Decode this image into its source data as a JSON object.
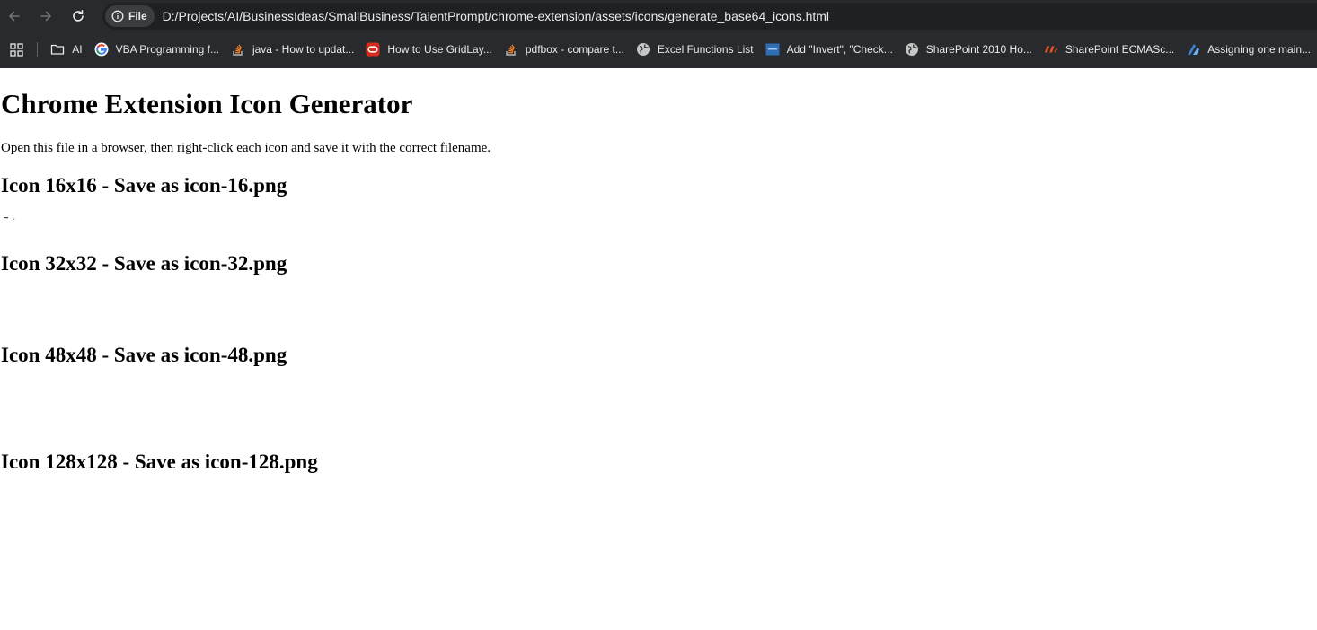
{
  "browser": {
    "site_chip_label": "File",
    "url": "D:/Projects/AI/BusinessIdeas/SmallBusiness/TalentPrompt/chrome-extension/assets/icons/generate_base64_icons.html",
    "bookmarks": [
      {
        "label": "AI",
        "icon": "folder-icon"
      },
      {
        "label": "VBA Programming f...",
        "icon": "google-icon"
      },
      {
        "label": "java - How to updat...",
        "icon": "stackoverflow-icon"
      },
      {
        "label": "How to Use GridLay...",
        "icon": "oracle-icon"
      },
      {
        "label": "pdfbox - compare t...",
        "icon": "stackoverflow-icon"
      },
      {
        "label": "Excel Functions List",
        "icon": "globe-icon"
      },
      {
        "label": "Add \"Invert\", \"Check...",
        "icon": "site-icon"
      },
      {
        "label": "SharePoint 2010 Ho...",
        "icon": "globe-icon"
      },
      {
        "label": "SharePoint ECMASc...",
        "icon": "site-logo-icon"
      },
      {
        "label": "Assigning one main...",
        "icon": "site-icon"
      }
    ]
  },
  "page": {
    "title": "Chrome Extension Icon Generator",
    "instructions": "Open this file in a browser, then right-click each icon and save it with the correct filename.",
    "sections": [
      {
        "heading": "Icon 16x16 - Save as icon-16.png"
      },
      {
        "heading": "Icon 32x32 - Save as icon-32.png"
      },
      {
        "heading": "Icon 48x48 - Save as icon-48.png"
      },
      {
        "heading": "Icon 128x128 - Save as icon-128.png"
      }
    ]
  },
  "colors": {
    "chrome_bg": "#292a2d",
    "omnibox_bg": "#1f2023",
    "chrome_text": "#e8eaed",
    "page_bg": "#ffffff",
    "page_text": "#000000"
  }
}
